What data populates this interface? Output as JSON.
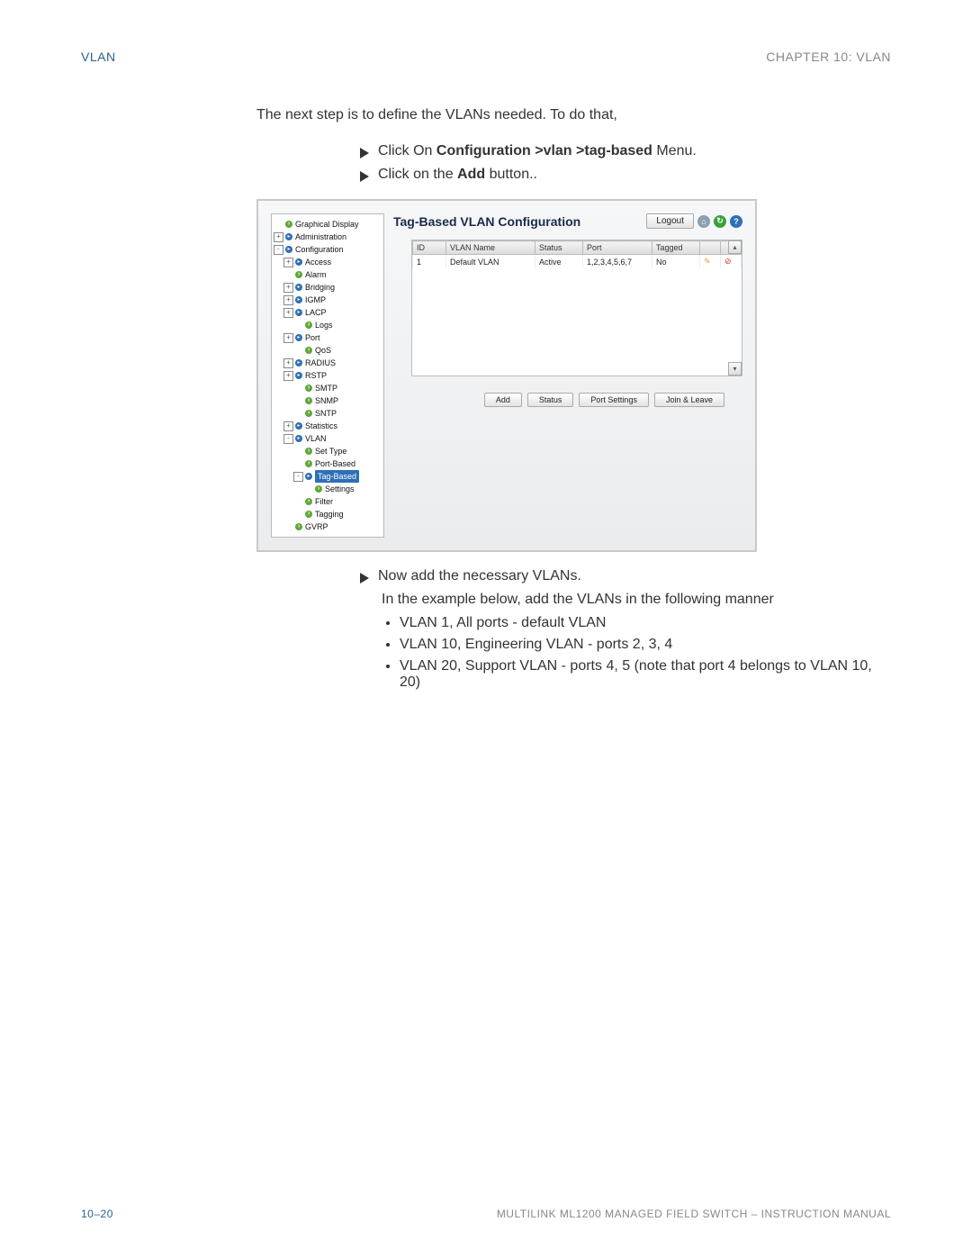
{
  "header": {
    "left": "Vlan",
    "right": "CHAPTER 10: VLAN"
  },
  "intro": "The next step is to define the VLANs needed. To do that,",
  "step1": {
    "pre": "Click On ",
    "bold": "Configuration >vlan >tag-based",
    "post": " Menu."
  },
  "step2": {
    "pre": "Click on the ",
    "bold": "Add",
    "post": " button.."
  },
  "shot": {
    "title": "Tag-Based VLAN Configuration",
    "logout": "Logout",
    "tree": [
      {
        "ind": 0,
        "pm": "",
        "ico": "dot",
        "label": "Graphical Display"
      },
      {
        "ind": 0,
        "pm": "+",
        "ico": "arrow",
        "label": "Administration"
      },
      {
        "ind": 0,
        "pm": "-",
        "ico": "arrow",
        "label": "Configuration"
      },
      {
        "ind": 1,
        "pm": "+",
        "ico": "arrow",
        "label": "Access"
      },
      {
        "ind": 1,
        "pm": "",
        "ico": "dot",
        "label": "Alarm"
      },
      {
        "ind": 1,
        "pm": "+",
        "ico": "arrow",
        "label": "Bridging"
      },
      {
        "ind": 1,
        "pm": "+",
        "ico": "arrow",
        "label": "IGMP"
      },
      {
        "ind": 1,
        "pm": "+",
        "ico": "arrow",
        "label": "LACP"
      },
      {
        "ind": 2,
        "pm": "",
        "ico": "dot",
        "label": "Logs"
      },
      {
        "ind": 1,
        "pm": "+",
        "ico": "arrow",
        "label": "Port"
      },
      {
        "ind": 2,
        "pm": "",
        "ico": "dot",
        "label": "QoS"
      },
      {
        "ind": 1,
        "pm": "+",
        "ico": "arrow",
        "label": "RADIUS"
      },
      {
        "ind": 1,
        "pm": "+",
        "ico": "arrow",
        "label": "RSTP"
      },
      {
        "ind": 2,
        "pm": "",
        "ico": "dot",
        "label": "SMTP"
      },
      {
        "ind": 2,
        "pm": "",
        "ico": "dot",
        "label": "SNMP"
      },
      {
        "ind": 2,
        "pm": "",
        "ico": "dot",
        "label": "SNTP"
      },
      {
        "ind": 1,
        "pm": "+",
        "ico": "arrow",
        "label": "Statistics"
      },
      {
        "ind": 1,
        "pm": "-",
        "ico": "arrow",
        "label": "VLAN"
      },
      {
        "ind": 2,
        "pm": "",
        "ico": "dot",
        "label": "Set Type"
      },
      {
        "ind": 2,
        "pm": "",
        "ico": "dot",
        "label": "Port-Based"
      },
      {
        "ind": 2,
        "pm": "-",
        "ico": "arrow",
        "label": "Tag-Based",
        "sel": true
      },
      {
        "ind": 3,
        "pm": "",
        "ico": "dot",
        "label": "Settings"
      },
      {
        "ind": 2,
        "pm": "",
        "ico": "dot",
        "label": "Filter"
      },
      {
        "ind": 2,
        "pm": "",
        "ico": "dot",
        "label": "Tagging"
      },
      {
        "ind": 1,
        "pm": "",
        "ico": "dot",
        "label": "GVRP"
      }
    ],
    "cols": {
      "id": "ID",
      "name": "VLAN Name",
      "status": "Status",
      "port": "Port",
      "tagged": "Tagged"
    },
    "row": {
      "id": "1",
      "name": "Default VLAN",
      "status": "Active",
      "port": "1,2,3,4,5,6,7",
      "tagged": "No"
    },
    "btns": {
      "add": "Add",
      "status": "Status",
      "ports": "Port Settings",
      "join": "Join & Leave"
    }
  },
  "step3": "Now add the necessary VLANs.",
  "example_intro": "In the example below, add the VLANs in the following manner",
  "bullets": [
    "VLAN 1, All ports - default VLAN",
    "VLAN 10, Engineering VLAN - ports 2, 3, 4",
    "VLAN 20, Support VLAN - ports 4, 5 (note that port 4 belongs to VLAN 10, 20)"
  ],
  "footer": {
    "left": "10–20",
    "right": "MULTILINK ML1200 MANAGED FIELD SWITCH – INSTRUCTION MANUAL"
  }
}
